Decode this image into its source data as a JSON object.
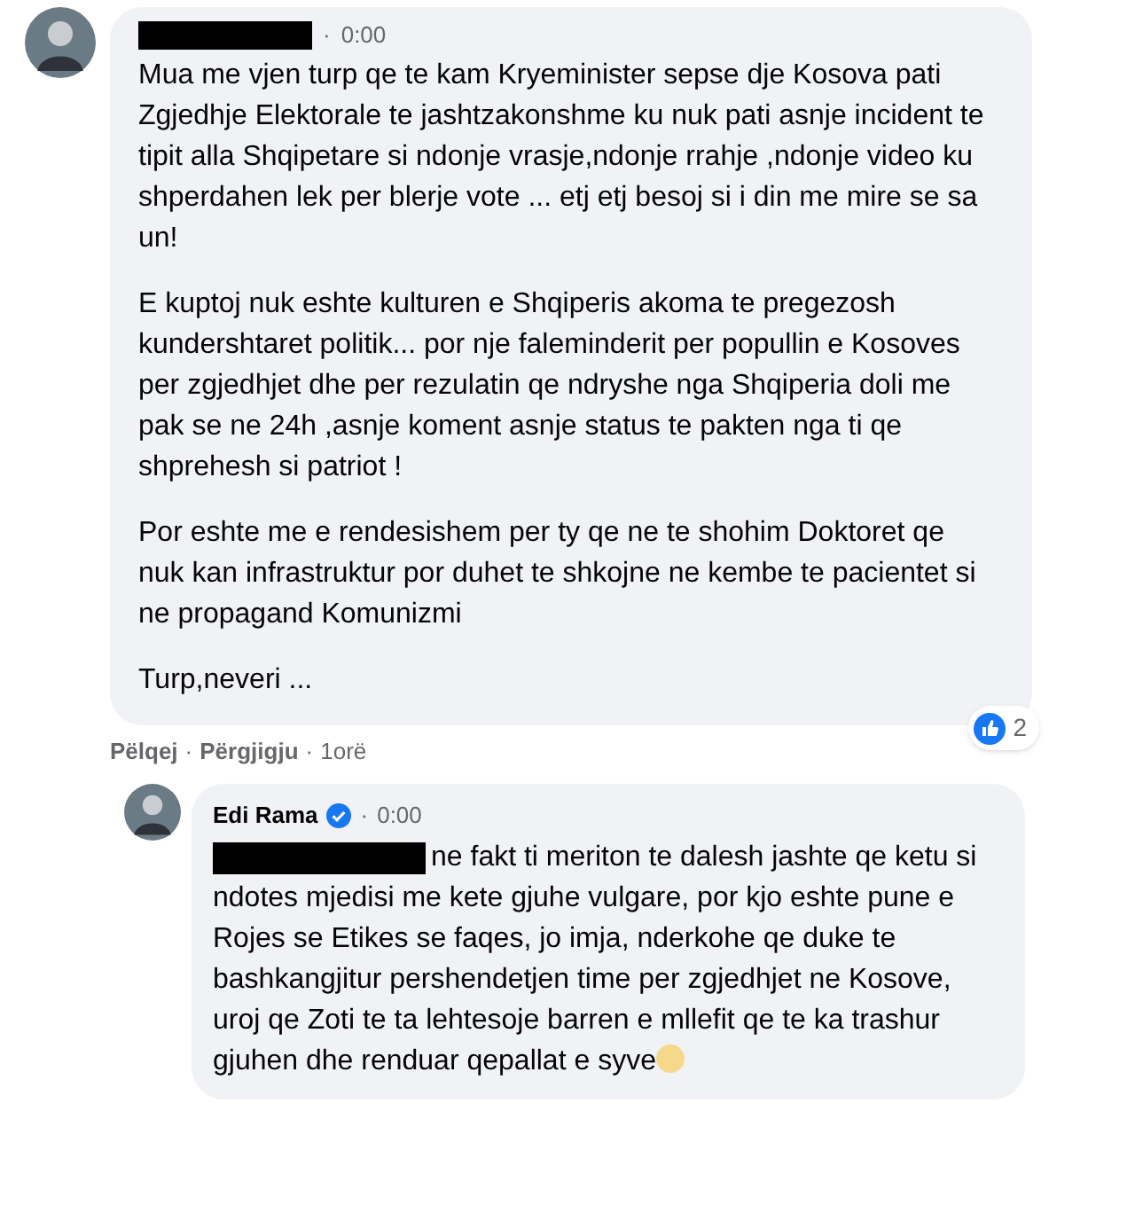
{
  "comment": {
    "author_redacted": true,
    "separator": "·",
    "time": "0:00",
    "paragraphs": [
      "Mua me vjen turp qe te kam Kryeminister sepse dje Kosova pati Zgjedhje Elektorale te jashtzakonshme ku nuk pati asnje incident te tipit alla Shqipetare si ndonje vrasje,ndonje rrahje ,ndonje video ku shperdahen lek per blerje vote ... etj etj besoj si i din me mire se sa un!",
      "E kuptoj nuk eshte kulturen e Shqiperis akoma te pregezosh kundershtaret politik... por nje faleminderit per popullin e Kosoves per zgjedhjet dhe per rezulatin qe ndryshe nga Shqiperia doli me pak se ne 24h ,asnje koment asnje status te pakten nga ti qe shprehesh si patriot !",
      "Por eshte me e rendesishem per ty qe ne te shohim Doktoret qe nuk kan infrastruktur por duhet te shkojne ne kembe te pacientet si ne propagand Komunizmi",
      "Turp,neveri ..."
    ],
    "actions": [
      "Pëlqej",
      "Përgjigju",
      "1orë"
    ],
    "reaction_count": "2"
  },
  "reply": {
    "author": "Edi Rama",
    "verified": true,
    "separator": "·",
    "time": "0:00",
    "mention_redacted": true,
    "text": "ne fakt ti meriton te dalesh jashte qe ketu si ndotes mjedisi me kete gjuhe vulgare, por kjo eshte pune e Rojes se Etikes se faqes, jo imja, nderkohe qe duke te bashkangjitur pershendetjen time per zgjedhjet ne Kosove, uroj qe Zoti te ta lehtesoje barren e mllefit qe te ka trashur gjuhen dhe renduar qepallat e syve"
  }
}
